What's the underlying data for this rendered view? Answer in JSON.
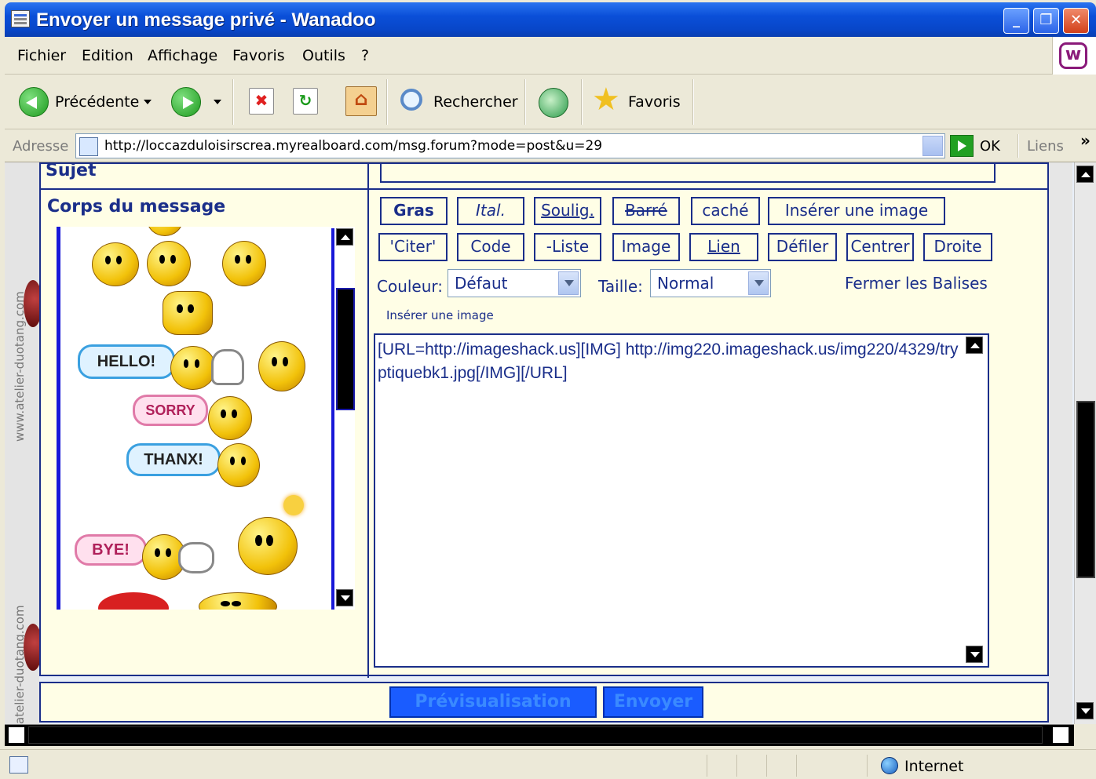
{
  "window": {
    "title": "Envoyer un message privé - Wanadoo"
  },
  "menu": [
    "Fichier",
    "Edition",
    "Affichage",
    "Favoris",
    "Outils",
    "?"
  ],
  "toolbar": {
    "back_label": "Précédente",
    "search_label": "Rechercher",
    "favorites_label": "Favoris"
  },
  "address": {
    "label": "Adresse",
    "url": "http://loccazduloisirscrea.myrealboard.com/msg.forum?mode=post&u=29",
    "go_label": "OK",
    "links_label": "Liens",
    "chevron": "»"
  },
  "side_watermark": "www.atelier-duotang.com",
  "side_watermark_2": "atelier-duotang.com",
  "form": {
    "subject_label": "Sujet",
    "body_label": "Corps du message",
    "format_buttons": [
      "Gras",
      "Ital.",
      "Soulig.",
      "Barré",
      "caché",
      "Insérer une image",
      "'Citer'",
      "Code",
      "-Liste",
      "Image",
      "Lien",
      "Défiler",
      "Centrer",
      "Droite"
    ],
    "color_label": "Couleur:",
    "color_value": "Défaut",
    "size_label": "Taille:",
    "size_value": "Normal",
    "close_tags_label": "Fermer les Balises",
    "hint": "Insérer une image",
    "message_text": "[URL=http://imageshack.us][IMG] http://img220.imageshack.us/img220/4329/tryptiquebk1.jpg[/IMG][/URL]",
    "preview_button": "Prévisualisation",
    "send_button": "Envoyer"
  },
  "smileys": {
    "bubbles": [
      "HELLO!",
      "SORRY",
      "THANX!",
      "BYE!"
    ]
  },
  "status": {
    "zone": "Internet"
  },
  "colors": {
    "accent": "#1a2e8a",
    "form_bg": "#fffee6",
    "submit_button": "#1a5cff"
  }
}
